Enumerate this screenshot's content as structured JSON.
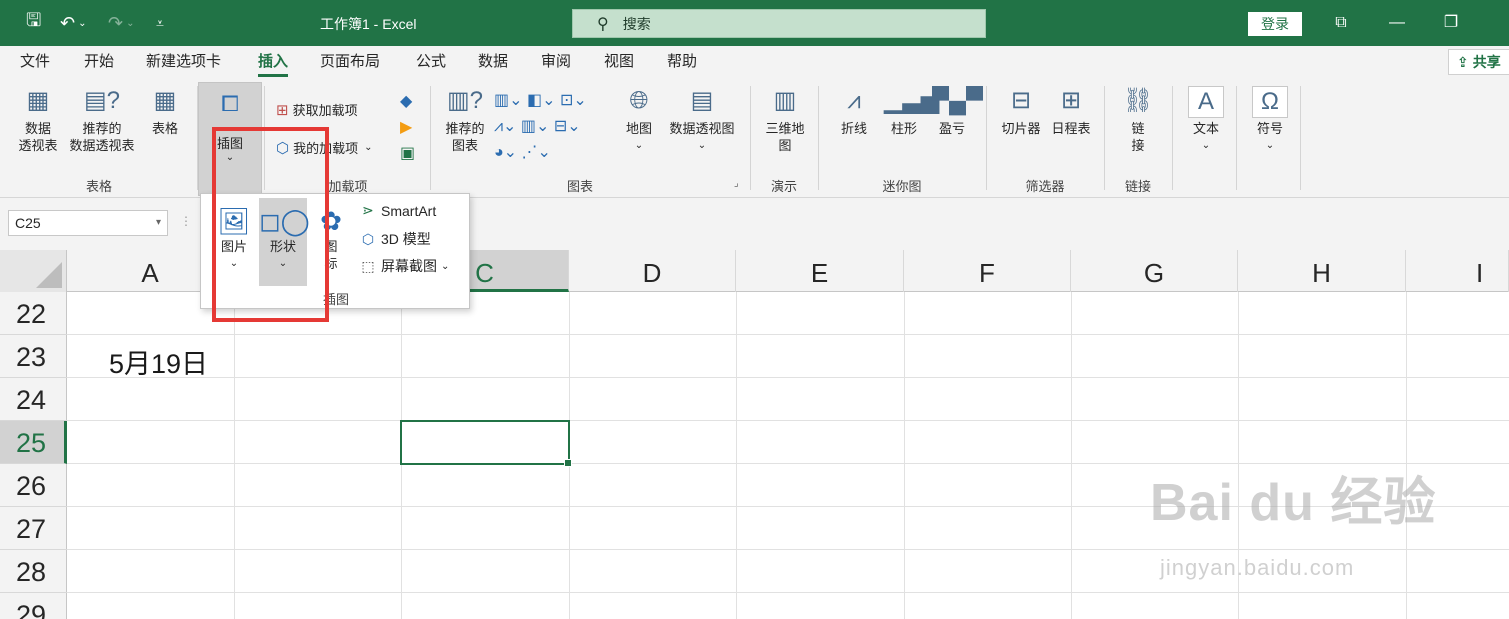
{
  "titlebar": {
    "title": "工作簿1  -  Excel",
    "search": "搜索",
    "login": "登录"
  },
  "tabs": [
    "文件",
    "开始",
    "新建选项卡",
    "插入",
    "页面布局",
    "公式",
    "数据",
    "审阅",
    "视图",
    "帮助"
  ],
  "active_tab": "插入",
  "share": "共享",
  "ribbon": {
    "table_group": {
      "label": "表格",
      "pivot": "数据\n透视表",
      "recommended_pivot": "推荐的\n数据透视表",
      "table": "表格"
    },
    "illustrations": {
      "label": "插图"
    },
    "addins_group": {
      "label": "加载项",
      "get_addins": "获取加载项",
      "my_addins": "我的加载项"
    },
    "charts_group": {
      "label": "图表",
      "recommended_charts": "推荐的\n图表",
      "map": "地图",
      "pivot_chart": "数据透视图"
    },
    "tours_group": {
      "label": "演示",
      "map3d": "三维地\n图"
    },
    "sparklines_group": {
      "label": "迷你图",
      "line": "折线",
      "column": "柱形",
      "winloss": "盈亏"
    },
    "filters_group": {
      "label": "筛选器",
      "slicer": "切片器",
      "timeline": "日程表"
    },
    "links_group": {
      "label": "链接",
      "link": "链\n接"
    },
    "text": "文本",
    "symbols": "符号"
  },
  "namebox": "C25",
  "columns": [
    "A",
    "B",
    "C",
    "D",
    "E",
    "F",
    "G",
    "H",
    "I"
  ],
  "rows": [
    "22",
    "23",
    "24",
    "25",
    "26",
    "27",
    "28",
    "29"
  ],
  "cells": {
    "A23": "5月19日"
  },
  "dropdown": {
    "pictures": "图片",
    "shapes": "形状",
    "icons": "图\n标",
    "smartart": "SmartArt",
    "model3d": "3D 模型",
    "screenshot": "屏幕截图",
    "label": "插图"
  },
  "watermark": {
    "brand": "Bai du 经验",
    "url": "jingyan.baidu.com"
  }
}
